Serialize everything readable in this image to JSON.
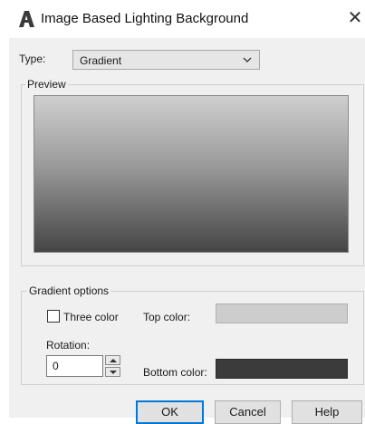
{
  "window": {
    "title": "Image Based Lighting Background",
    "close_glyph": "✕",
    "app_icon": "autocad-a-icon"
  },
  "type": {
    "label": "Type:",
    "selected": "Gradient",
    "dropdown_icon": "chevron-down-icon"
  },
  "preview": {
    "label": "Preview",
    "gradient_colors": [
      "#cfcfcf",
      "#9a9a9a",
      "#454545"
    ]
  },
  "gradient_options": {
    "label": "Gradient options",
    "three_color_label": "Three color",
    "three_color_checked": false,
    "top_color_label": "Top color:",
    "top_color": "#cdcdcd",
    "rotation_label": "Rotation:",
    "rotation_value": "0",
    "bottom_color_label": "Bottom color:",
    "bottom_color": "#3b3b3b"
  },
  "buttons": {
    "ok": "OK",
    "cancel": "Cancel",
    "help": "Help"
  }
}
